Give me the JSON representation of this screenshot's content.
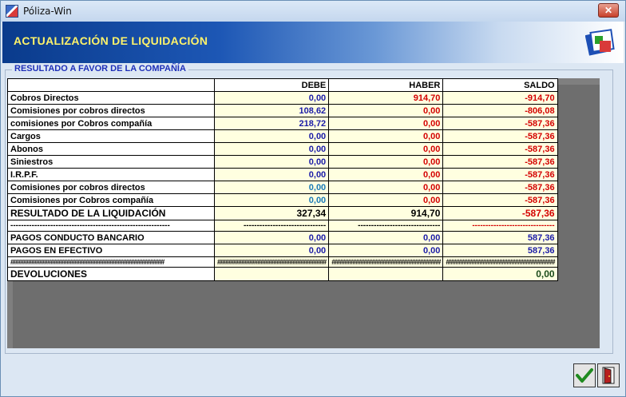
{
  "window": {
    "title": "Póliza-Win",
    "close_label": "✕"
  },
  "banner": {
    "title": "ACTUALIZACIÓN DE LIQUIDACIÓN"
  },
  "group": {
    "title": "RESULTADO A FAVOR DE LA COMPAÑÍA"
  },
  "table": {
    "headers": [
      "",
      "DEBE",
      "HABER",
      "SALDO"
    ],
    "rows": [
      {
        "label": "Cobros Directos",
        "debe": "0,00",
        "haber": "914,70",
        "saldo": "-914,70"
      },
      {
        "label": "Comisiones por cobros directos",
        "debe": "108,62",
        "haber": "0,00",
        "saldo": "-806,08"
      },
      {
        "label": "comisiones por Cobros compañía",
        "debe": "218,72",
        "haber": "0,00",
        "saldo": "-587,36"
      },
      {
        "label": "Cargos",
        "debe": "0,00",
        "haber": "0,00",
        "saldo": "-587,36"
      },
      {
        "label": "Abonos",
        "debe": "0,00",
        "haber": "0,00",
        "saldo": "-587,36"
      },
      {
        "label": "Siniestros",
        "debe": "0,00",
        "haber": "0,00",
        "saldo": "-587,36"
      },
      {
        "label": "I.R.P.F.",
        "debe": "0,00",
        "haber": "0,00",
        "saldo": "-587,36"
      },
      {
        "label": "Comisiones por cobros directos",
        "debe": "0,00",
        "haber": "0,00",
        "saldo": "-587,36"
      },
      {
        "label": "Comisiones por Cobros compañía",
        "debe": "0,00",
        "haber": "0,00",
        "saldo": "-587,36"
      },
      {
        "label": "RESULTADO DE LA LIQUIDACIÓN",
        "debe": "327,34",
        "haber": "914,70",
        "saldo": "-587,36"
      },
      {
        "label": "------------------------------------------------------------",
        "debe": "-------------------------------",
        "haber": "-------------------------------",
        "saldo": "-------------------------------"
      },
      {
        "label": "PAGOS CONDUCTO BANCARIO",
        "debe": "0,00",
        "haber": "0,00",
        "saldo": "587,36"
      },
      {
        "label": "PAGOS EN EFECTIVO",
        "debe": "0,00",
        "haber": "0,00",
        "saldo": "587,36"
      },
      {
        "label": "################################################",
        "debe": "##################################",
        "haber": "##################################",
        "saldo": "##################################"
      },
      {
        "label": "DEVOLUCIONES",
        "debe": "",
        "haber": "",
        "saldo": "0,00"
      }
    ]
  },
  "buttons": {
    "accept_icon": "check-icon",
    "exit_icon": "exit-door-icon"
  },
  "colors": {
    "banner_text": "#fff36a",
    "group_title": "#1e2fb8",
    "grid_bg": "#7f7f7f",
    "cell_bg": "#ffffe0"
  }
}
